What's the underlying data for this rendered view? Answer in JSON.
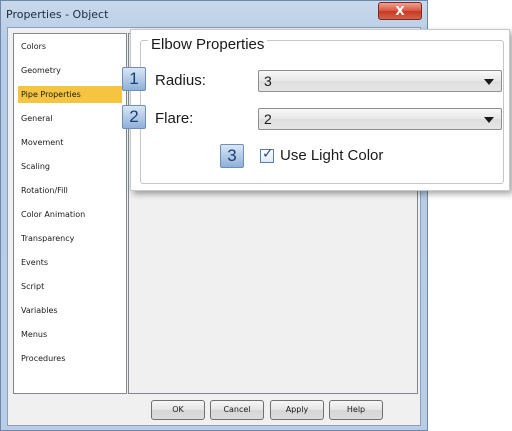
{
  "window": {
    "title": "Properties - Object",
    "close_glyph": "X"
  },
  "sidebar": {
    "items": [
      {
        "label": "Colors",
        "selected": false
      },
      {
        "label": "Geometry",
        "selected": false
      },
      {
        "label": "Pipe Properties",
        "selected": true
      },
      {
        "label": "General",
        "selected": false
      },
      {
        "label": "Movement",
        "selected": false
      },
      {
        "label": "Scaling",
        "selected": false
      },
      {
        "label": "Rotation/Fill",
        "selected": false
      },
      {
        "label": "Color Animation",
        "selected": false
      },
      {
        "label": "Transparency",
        "selected": false
      },
      {
        "label": "Events",
        "selected": false
      },
      {
        "label": "Script",
        "selected": false
      },
      {
        "label": "Variables",
        "selected": false
      },
      {
        "label": "Menus",
        "selected": false
      },
      {
        "label": "Procedures",
        "selected": false
      }
    ]
  },
  "buttons": {
    "ok": "OK",
    "cancel": "Cancel",
    "apply": "Apply",
    "help": "Help"
  },
  "elbow": {
    "group_title": "Elbow Properties",
    "radius_callout": "1",
    "radius_label": "Radius:",
    "radius_value": "3",
    "flare_callout": "2",
    "flare_label": "Flare:",
    "flare_value": "2",
    "light_callout": "3",
    "light_label": "Use Light Color",
    "light_checked": true,
    "checkmark": "✓"
  },
  "colors": {
    "selection": "#f5c542",
    "callout_text": "#1b3f73",
    "close_button": "#d8523c"
  },
  "icons": [
    "close-icon",
    "chevron-down-icon",
    "checkmark-icon"
  ]
}
